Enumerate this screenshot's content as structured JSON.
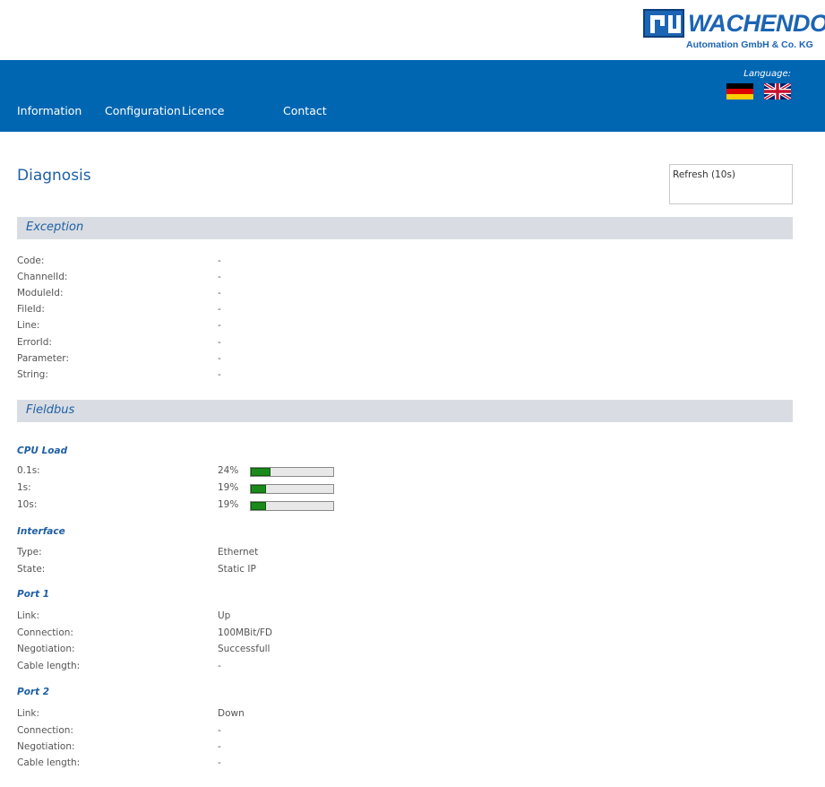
{
  "brand": {
    "name": "WACHENDORFF",
    "subline": "Automation GmbH & Co. KG"
  },
  "nav": {
    "items": [
      "Information",
      "Configuration",
      "Licence",
      "Contact"
    ],
    "language_label": "Language:"
  },
  "page": {
    "title": "Diagnosis",
    "refresh_label": "Refresh (10s)"
  },
  "exception": {
    "title": "Exception",
    "rows": [
      {
        "label": "Code:",
        "value": "-"
      },
      {
        "label": "ChannelId:",
        "value": "-"
      },
      {
        "label": "ModuleId:",
        "value": "-"
      },
      {
        "label": "FileId:",
        "value": "-"
      },
      {
        "label": "Line:",
        "value": "-"
      },
      {
        "label": "ErrorId:",
        "value": "-"
      },
      {
        "label": "Parameter:",
        "value": "-"
      },
      {
        "label": "String:",
        "value": "-"
      }
    ]
  },
  "fieldbus": {
    "title": "Fieldbus",
    "cpu_load": {
      "title": "CPU Load",
      "rows": [
        {
          "label": "0.1s:",
          "value": "24%",
          "percent": 24
        },
        {
          "label": "1s:",
          "value": "19%",
          "percent": 19
        },
        {
          "label": "10s:",
          "value": "19%",
          "percent": 19
        }
      ]
    },
    "interface": {
      "title": "Interface",
      "rows": [
        {
          "label": "Type:",
          "value": "Ethernet"
        },
        {
          "label": "State:",
          "value": "Static IP"
        }
      ]
    },
    "port1": {
      "title": "Port 1",
      "rows": [
        {
          "label": "Link:",
          "value": "Up"
        },
        {
          "label": "Connection:",
          "value": "100MBit/FD"
        },
        {
          "label": "Negotiation:",
          "value": "Successfull"
        },
        {
          "label": "Cable length:",
          "value": "-"
        }
      ]
    },
    "port2": {
      "title": "Port 2",
      "rows": [
        {
          "label": "Link:",
          "value": "Down"
        },
        {
          "label": "Connection:",
          "value": "-"
        },
        {
          "label": "Negotiation:",
          "value": "-"
        },
        {
          "label": "Cable length:",
          "value": "-"
        }
      ]
    }
  },
  "colors": {
    "nav_bg": "#0066b2",
    "accent": "#1f5fa4",
    "bar_fill": "#1a8a1a"
  }
}
